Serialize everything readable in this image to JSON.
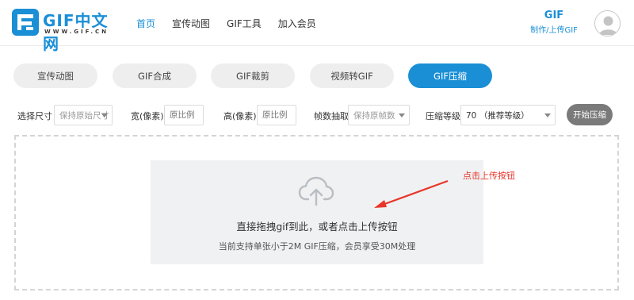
{
  "header": {
    "logo_text": "GIF中文网",
    "logo_sub": "WWW.GIF.CN",
    "nav": [
      {
        "label": "首页",
        "active": true
      },
      {
        "label": "宣传动图",
        "active": false
      },
      {
        "label": "GIF工具",
        "active": false
      },
      {
        "label": "加入会员",
        "active": false
      }
    ],
    "user": {
      "gif_label": "GIF",
      "link_label": "制作/上传GIF"
    }
  },
  "tabs": [
    {
      "label": "宣传动图",
      "active": false
    },
    {
      "label": "GIF合成",
      "active": false
    },
    {
      "label": "GIF裁剪",
      "active": false
    },
    {
      "label": "视频转GIF",
      "active": false
    },
    {
      "label": "GIF压缩",
      "active": true
    }
  ],
  "settings": {
    "size_label": "选择尺寸",
    "size_value": "保持原始尺寸",
    "width_label": "宽(像素)",
    "width_placeholder": "原比例",
    "height_label": "高(像素)",
    "height_placeholder": "原比例",
    "frame_label": "帧数抽取",
    "frame_value": "保持原帧数",
    "level_label": "压缩等级",
    "level_value": "70 （推荐等级）",
    "start_label": "开始压缩"
  },
  "upload": {
    "main_text": "直接拖拽gif到此，或者点击上传按钮",
    "sub_text": "当前支持单张小于2M GIF压缩，会员享受30M处理",
    "annotation": "点击上传按钮"
  },
  "colors": {
    "accent": "#1a8fd6",
    "annotation": "#e8352a",
    "button_gray": "#7a7a7a"
  }
}
